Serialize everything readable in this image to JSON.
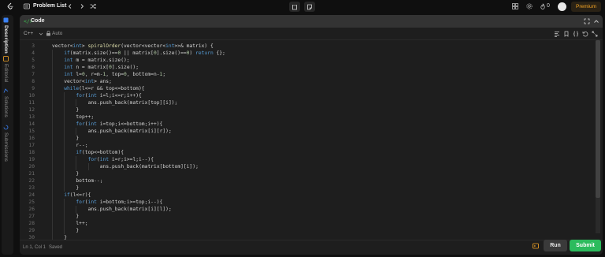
{
  "topbar": {
    "problem_list_label": "Problem List",
    "fire_count": "0",
    "premium_label": "Premium",
    "icons": [
      "logo-icon",
      "list-icon",
      "prev-arrow-icon",
      "next-arrow-icon",
      "shuffle-icon",
      "timer-icon",
      "notes-icon",
      "grid-icon",
      "settings-icon",
      "fire-icon"
    ]
  },
  "sidebar": {
    "tabs": [
      {
        "label": "Description",
        "active": true
      },
      {
        "label": "Editorial",
        "active": false
      },
      {
        "label": "Solutions",
        "active": false
      },
      {
        "label": "Submissions",
        "active": false
      }
    ]
  },
  "panel": {
    "title": "Code",
    "title_icon": "</>",
    "language": "C++",
    "mode": "Auto"
  },
  "editor": {
    "lines": [
      {
        "n": "3",
        "indent": 0,
        "tokens": [
          [
            "",
            "vector"
          ],
          [
            "",
            "<"
          ],
          [
            "kw",
            "int"
          ],
          [
            "",
            "> "
          ],
          [
            "fn",
            "spiralOrder"
          ],
          [
            "",
            "("
          ],
          [
            "",
            "vector"
          ],
          [
            "",
            "<"
          ],
          [
            "",
            "vector"
          ],
          [
            "",
            "<"
          ],
          [
            "kw",
            "int"
          ],
          [
            "",
            ">>& matrix) {"
          ]
        ]
      },
      {
        "n": "4",
        "indent": 1,
        "tokens": [
          [
            "kw",
            "if"
          ],
          [
            "",
            "(matrix.size()=="
          ],
          [
            "num",
            "0"
          ],
          [
            "",
            " || matrix["
          ],
          [
            "num",
            "0"
          ],
          [
            "",
            "].size()=="
          ],
          [
            "num",
            "0"
          ],
          [
            "",
            ") "
          ],
          [
            "kw",
            "return"
          ],
          [
            "",
            " {};"
          ]
        ]
      },
      {
        "n": "5",
        "indent": 1,
        "tokens": [
          [
            "kw",
            "int"
          ],
          [
            "",
            " m = matrix.size();"
          ]
        ]
      },
      {
        "n": "6",
        "indent": 1,
        "tokens": [
          [
            "kw",
            "int"
          ],
          [
            "",
            " n = matrix["
          ],
          [
            "num",
            "0"
          ],
          [
            "",
            "].size();"
          ]
        ]
      },
      {
        "n": "7",
        "indent": 1,
        "tokens": [
          [
            "kw",
            "int"
          ],
          [
            "",
            " l="
          ],
          [
            "num",
            "0"
          ],
          [
            "",
            ", r=m-"
          ],
          [
            "num",
            "1"
          ],
          [
            "",
            ", top="
          ],
          [
            "num",
            "0"
          ],
          [
            "",
            ", bottom=n-"
          ],
          [
            "num",
            "1"
          ],
          [
            "",
            ";"
          ]
        ]
      },
      {
        "n": "8",
        "indent": 1,
        "tokens": [
          [
            "",
            "vector<"
          ],
          [
            "kw",
            "int"
          ],
          [
            "",
            "> ans;"
          ]
        ]
      },
      {
        "n": "9",
        "indent": 1,
        "tokens": [
          [
            "kw",
            "while"
          ],
          [
            "",
            "(l<=r && top<=bottom){"
          ]
        ]
      },
      {
        "n": "10",
        "indent": 2,
        "tokens": [
          [
            "kw",
            "for"
          ],
          [
            "",
            "("
          ],
          [
            "kw",
            "int"
          ],
          [
            "",
            " i=l;i<=r;i++){"
          ]
        ]
      },
      {
        "n": "11",
        "indent": 3,
        "tokens": [
          [
            "",
            "ans.push_back(matrix[top][i]);"
          ]
        ]
      },
      {
        "n": "12",
        "indent": 2,
        "tokens": [
          [
            "",
            "}"
          ]
        ]
      },
      {
        "n": "13",
        "indent": 2,
        "tokens": [
          [
            "",
            "top++;"
          ]
        ]
      },
      {
        "n": "14",
        "indent": 2,
        "tokens": [
          [
            "kw",
            "for"
          ],
          [
            "",
            "("
          ],
          [
            "kw",
            "int"
          ],
          [
            "",
            " i=top;i<=bottom;i++){"
          ]
        ]
      },
      {
        "n": "15",
        "indent": 3,
        "tokens": [
          [
            "",
            "ans.push_back(matrix[i][r]);"
          ]
        ]
      },
      {
        "n": "16",
        "indent": 2,
        "tokens": [
          [
            "",
            "}"
          ]
        ]
      },
      {
        "n": "17",
        "indent": 2,
        "tokens": [
          [
            "",
            "r--;"
          ]
        ]
      },
      {
        "n": "18",
        "indent": 2,
        "tokens": [
          [
            "kw",
            "if"
          ],
          [
            "",
            "(top<=bottom){"
          ]
        ]
      },
      {
        "n": "19",
        "indent": 3,
        "tokens": [
          [
            "kw",
            "for"
          ],
          [
            "",
            "("
          ],
          [
            "kw",
            "int"
          ],
          [
            "",
            " i=r;i>=l;i--){"
          ]
        ]
      },
      {
        "n": "20",
        "indent": 4,
        "tokens": [
          [
            "",
            "ans.push_back(matrix[bottom][i]);"
          ]
        ]
      },
      {
        "n": "21",
        "indent": 2,
        "tokens": [
          [
            "",
            "}"
          ]
        ]
      },
      {
        "n": "22",
        "indent": 2,
        "tokens": [
          [
            "",
            "bottom--;"
          ]
        ]
      },
      {
        "n": "23",
        "indent": 2,
        "tokens": [
          [
            "",
            "}"
          ]
        ]
      },
      {
        "n": "24",
        "indent": 1,
        "tokens": [
          [
            "kw",
            "if"
          ],
          [
            "",
            "(l<=r){"
          ]
        ]
      },
      {
        "n": "25",
        "indent": 2,
        "tokens": [
          [
            "kw",
            "for"
          ],
          [
            "",
            "("
          ],
          [
            "kw",
            "int"
          ],
          [
            "",
            " i=bottom;i>=top;i--){"
          ]
        ]
      },
      {
        "n": "26",
        "indent": 3,
        "tokens": [
          [
            "",
            "ans.push_back(matrix[i][l]);"
          ]
        ]
      },
      {
        "n": "27",
        "indent": 2,
        "tokens": [
          [
            "",
            "}"
          ]
        ]
      },
      {
        "n": "28",
        "indent": 2,
        "tokens": [
          [
            "",
            "l++;"
          ]
        ]
      },
      {
        "n": "29",
        "indent": 2,
        "tokens": [
          [
            "",
            "}"
          ]
        ]
      },
      {
        "n": "30",
        "indent": 1,
        "tokens": [
          [
            "",
            "}"
          ]
        ]
      }
    ]
  },
  "statusbar": {
    "position": "Ln 1, Col 1",
    "saved": "Saved"
  },
  "actions": {
    "run_label": "Run",
    "submit_label": "Submit"
  },
  "colors": {
    "accent_green": "#2cbb5d",
    "premium": "#f5a524"
  }
}
